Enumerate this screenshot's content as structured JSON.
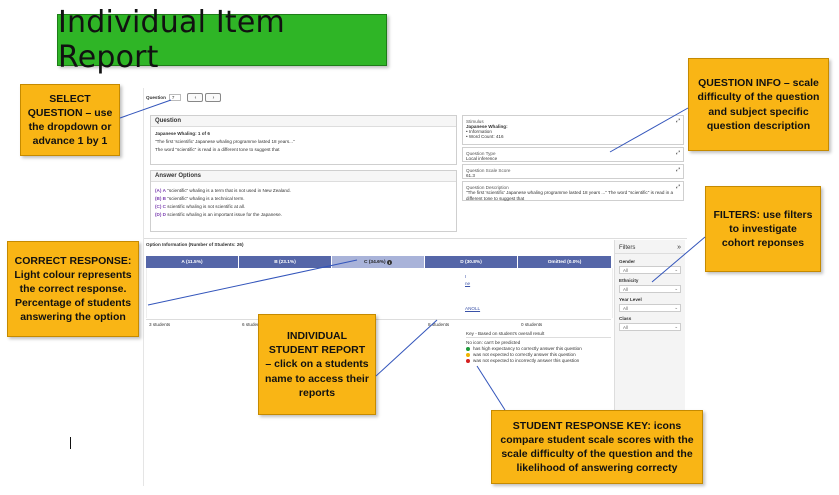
{
  "title": "Individual Item Report",
  "callouts": {
    "select_question": "SELECT QUESTION – use the dropdown or advance 1 by 1",
    "question_info": "QUESTION INFO – scale difficulty of the question and subject specific question description",
    "filters": "FILTERS: use filters to investigate cohort reponses",
    "correct_response": "CORRECT RESPONSE: Light colour represents the correct response. Percentage of students answering the option",
    "individual_student": "INDIVIDUAL STUDENT REPORT – click on a students name to access their reports",
    "response_key": "STUDENT RESPONSE KEY: icons compare student scale scores with the scale difficulty of the question and the likelihood of answering correcty"
  },
  "app": {
    "question_label": "Question",
    "question_value": "7",
    "question_panel": {
      "title": "Question",
      "heading": "Japanese Whaling: 1 of 6",
      "quote": "\"The first 'scientific' Japanese whaling programme lasted 18 years...\"",
      "prompt": "The word \"scientific\" is read in a different tone to suggest that"
    },
    "answer_options": {
      "title": "Answer Options",
      "items": [
        {
          "letter": "(A)",
          "key": "A",
          "text": "\"scientific\" whaling is a term that is not used in New Zealand."
        },
        {
          "letter": "(B)",
          "key": "B",
          "text": "\"scientific\" whaling is a technical term."
        },
        {
          "letter": "(C)",
          "key": "C",
          "text": "scientific whaling is not scientific at all."
        },
        {
          "letter": "(D)",
          "key": "D",
          "text": "scientific whaling is an important issue for the Japanese."
        }
      ]
    },
    "stimulus": {
      "label": "Stimulus",
      "title": "Japanese Whaling:",
      "bullets": [
        "Information",
        "Word Count: 416"
      ]
    },
    "question_type": {
      "label": "Question Type",
      "value": "Local inference"
    },
    "scale_score": {
      "label": "Question Scale Score",
      "value": "61.3"
    },
    "description": {
      "label": "Question Description",
      "value": "\"The first 'scientific' Japanese whaling programme lasted 18 years ...\" The word \"scientific\" is read in a different tone to suggest that"
    },
    "option_info_title": "Option Information (Number of Students: 26)",
    "options": [
      {
        "label": "A (11.5%)",
        "students": "3 students"
      },
      {
        "label": "B (23.1%)",
        "students": "6 students"
      },
      {
        "label": "C (34.6%)",
        "students": ""
      },
      {
        "label": "D (30.8%)",
        "students": "8 students"
      },
      {
        "label": "Omitted (0.0%)",
        "students": "0 students"
      }
    ],
    "colors": {
      "option_bar": "#5566a8",
      "correct_option": "#a9b3d9",
      "accent": "#f9b515",
      "title_green": "#2fb526"
    },
    "student_links": [
      "I",
      "ne",
      "ANOLL"
    ],
    "key": {
      "title": "Key - Based on student's overall result",
      "no_icon": "No icon: can't be predicted",
      "items": [
        {
          "color": "#1d9a3a",
          "text": "has high expectancy to correctly answer this question"
        },
        {
          "color": "#f0b400",
          "text": "was not expected to correctly answer this question"
        },
        {
          "color": "#d42020",
          "text": "was not expected to incorrectly answer this question"
        }
      ]
    },
    "filters": {
      "title": "Filters",
      "groups": [
        {
          "label": "Gender",
          "value": "All"
        },
        {
          "label": "Ethnicity",
          "value": "All"
        },
        {
          "label": "Year Level",
          "value": "All"
        },
        {
          "label": "Class",
          "value": "All"
        }
      ]
    }
  }
}
